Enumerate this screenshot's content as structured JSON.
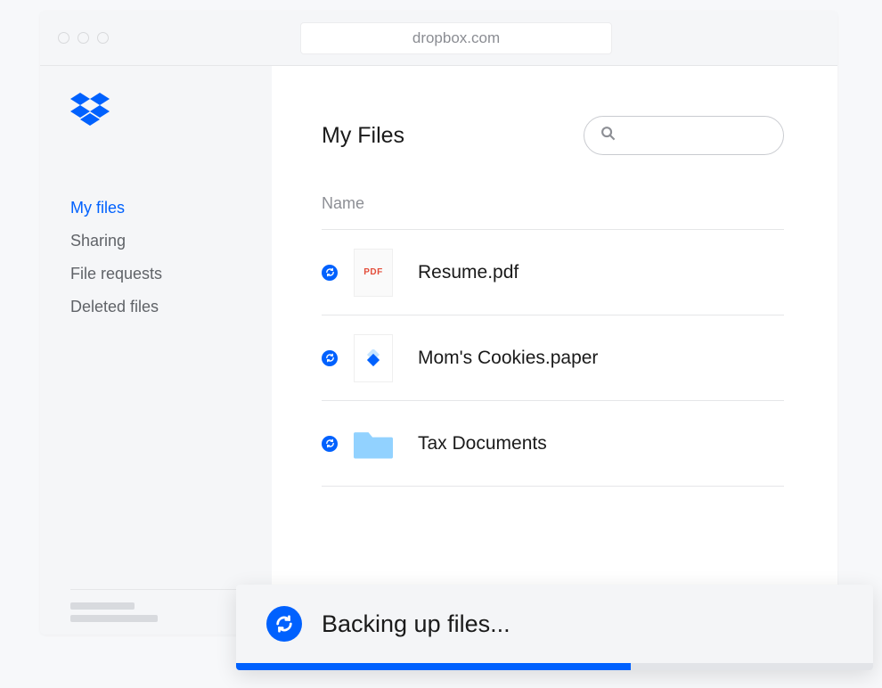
{
  "browser": {
    "url": "dropbox.com"
  },
  "sidebar": {
    "items": [
      {
        "label": "My files",
        "active": true
      },
      {
        "label": "Sharing",
        "active": false
      },
      {
        "label": "File requests",
        "active": false
      },
      {
        "label": "Deleted files",
        "active": false
      }
    ]
  },
  "main": {
    "title": "My Files",
    "column_header": "Name",
    "search_placeholder": ""
  },
  "files": [
    {
      "name": "Resume.pdf",
      "icon": "pdf",
      "syncing": true
    },
    {
      "name": "Mom's Cookies.paper",
      "icon": "paper",
      "syncing": true
    },
    {
      "name": "Tax Documents",
      "icon": "folder",
      "syncing": true
    }
  ],
  "toast": {
    "message": "Backing up files...",
    "progress_percent": 62
  },
  "colors": {
    "brand": "#0061fe",
    "folder": "#92d2ff"
  }
}
